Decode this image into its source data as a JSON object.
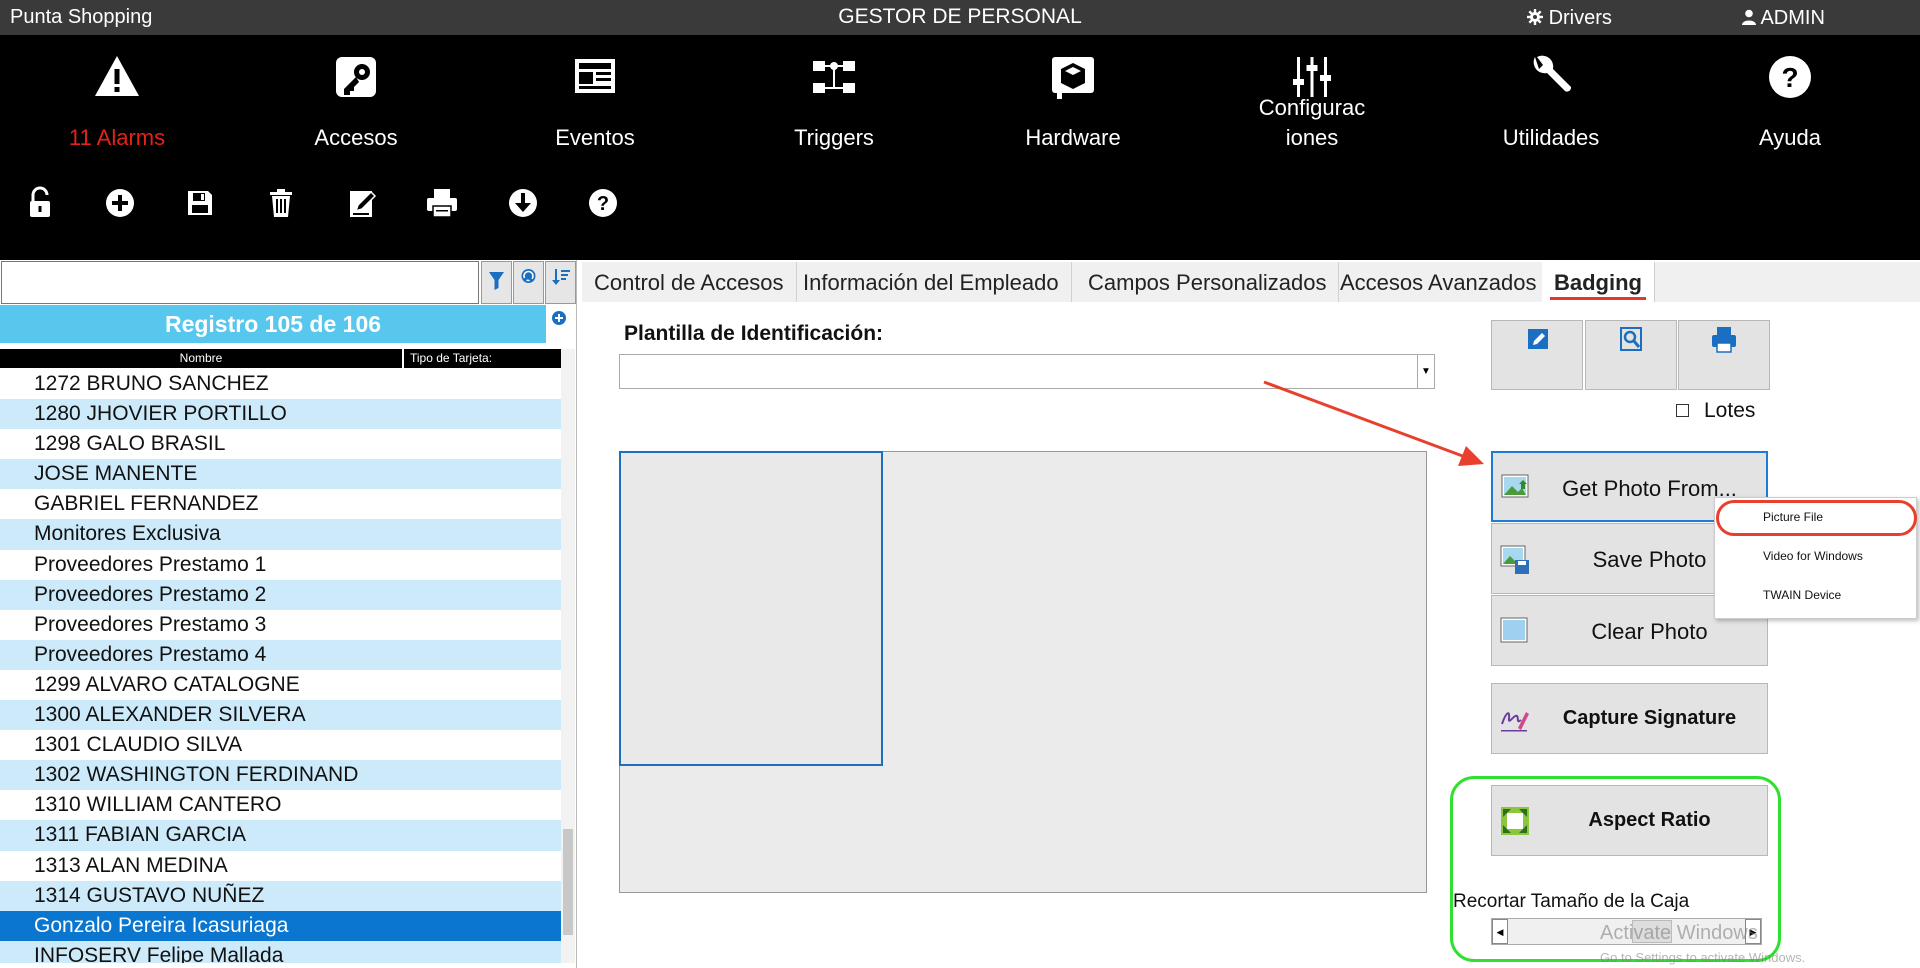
{
  "titlebar": {
    "app_name": "Punta Shopping",
    "title": "GESTOR DE PERSONAL",
    "drivers": "Drivers",
    "user": "ADMIN"
  },
  "nav": {
    "alarms": "11 Alarms",
    "accesos": "Accesos",
    "eventos": "Eventos",
    "triggers": "Triggers",
    "hardware": "Hardware",
    "config_line1": "Configurac",
    "config_line2": "iones",
    "utilidades": "Utilidades",
    "ayuda": "Ayuda"
  },
  "toolbar_icons": [
    "lock-icon",
    "add-icon",
    "save-icon",
    "trash-icon",
    "edit-icon",
    "print-icon",
    "download-icon",
    "help-icon"
  ],
  "search": {
    "value": ""
  },
  "registro": "Registro 105 de 106",
  "columns": {
    "nombre": "Nombre",
    "tipo": "Tipo de Tarjeta:"
  },
  "employees": [
    "1272 BRUNO SANCHEZ",
    "1280 JHOVIER PORTILLO",
    "1298 GALO BRASIL",
    "JOSE  MANENTE",
    "GABRIEL FERNANDEZ",
    "Monitores Exclusiva",
    "Proveedores Prestamo 1",
    "Proveedores Prestamo 2",
    "Proveedores Prestamo 3",
    "Proveedores Prestamo 4",
    "1299 ALVARO CATALOGNE",
    "1300 ALEXANDER SILVERA",
    "1301 CLAUDIO SILVA",
    "1302 WASHINGTON FERDINAND",
    "1310 WILLIAM CANTERO",
    "1311 FABIAN GARCIA",
    "1313 ALAN MEDINA",
    "1314 GUSTAVO NUÑEZ",
    "Gonzalo Pereira Icasuriaga",
    "INFOSERV Felipe Mallada"
  ],
  "selected_index": 18,
  "tabs": [
    "Control de Accesos",
    "Información del Empleado",
    "Campos Personalizados",
    "Accesos Avanzados",
    "Badging"
  ],
  "active_tab": "Badging",
  "badging": {
    "plantilla_label": "Plantilla de Identificación:",
    "plantilla_value": "",
    "lotes": "Lotes",
    "get_photo": "Get Photo From...",
    "save_photo": "Save Photo",
    "clear_photo": "Clear Photo",
    "capture_signature": "Capture Signature",
    "aspect_ratio": "Aspect Ratio",
    "recortar": "Recortar Tamaño de la Caja"
  },
  "context_menu": [
    "Picture File",
    "Video for Windows",
    "TWAIN Device"
  ],
  "watermark": {
    "line1": "Activate Windows",
    "line2": "Go to Settings to activate Windows."
  },
  "colors": {
    "accent_blue": "#58c7ee",
    "selection": "#0b76cf",
    "alarm_red": "#e4211b",
    "highlight_red": "#e8402d",
    "highlight_green": "#2fe02f"
  }
}
